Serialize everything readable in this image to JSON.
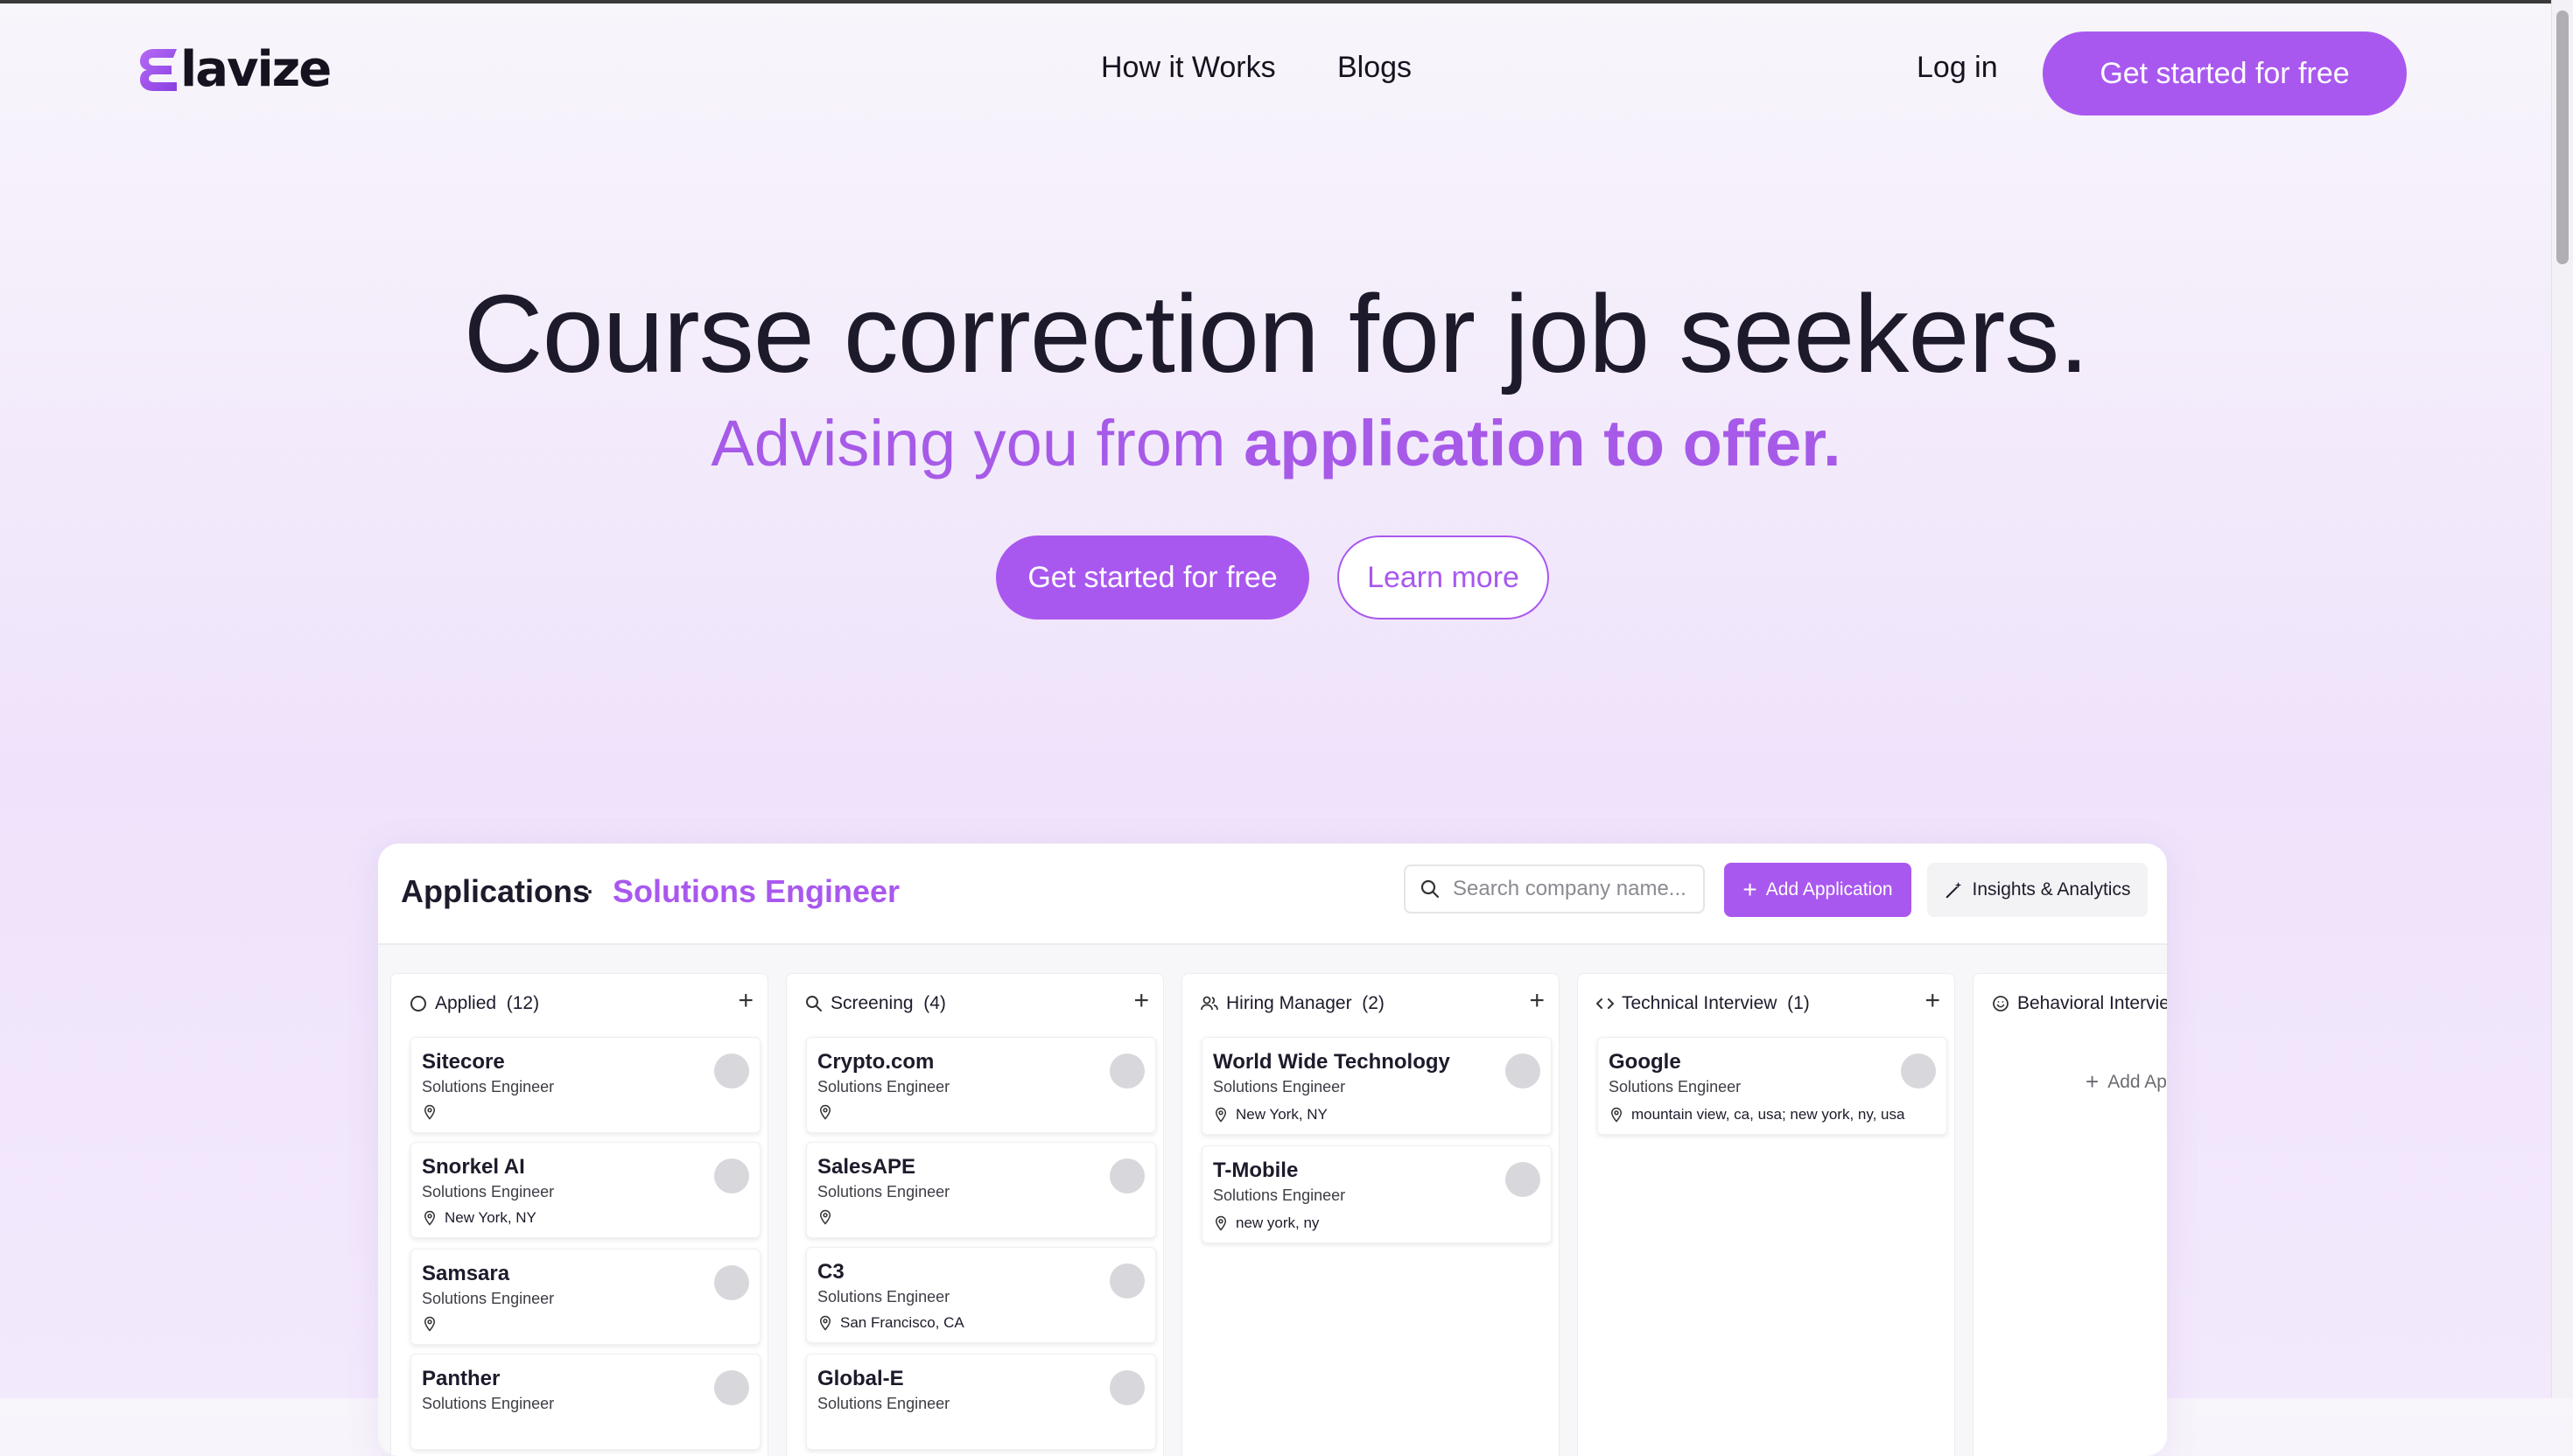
{
  "header": {
    "logo_text": "lavize",
    "nav": [
      "How it Works",
      "Blogs"
    ],
    "login": "Log in",
    "cta": "Get started for free"
  },
  "hero": {
    "title": "Course correction for job seekers.",
    "subtitle_plain": "Advising you from ",
    "subtitle_bold": "application to offer.",
    "cta_primary": "Get started for free",
    "cta_secondary": "Learn more"
  },
  "app": {
    "title": "Applications",
    "separator": "·",
    "role": "Solutions Engineer",
    "search_placeholder": "Search company name...",
    "add_button": "Add Application",
    "insights_button": "Insights & Analytics",
    "columns": [
      {
        "icon": "circle-icon",
        "label": "Applied",
        "count": "(12)",
        "cards": [
          {
            "name": "Sitecore",
            "role": "Solutions Engineer",
            "location": ""
          },
          {
            "name": "Snorkel AI",
            "role": "Solutions Engineer",
            "location": "New York, NY"
          },
          {
            "name": "Samsara",
            "role": "Solutions Engineer",
            "location": ""
          },
          {
            "name": "Panther",
            "role": "Solutions Engineer",
            "location": ""
          }
        ]
      },
      {
        "icon": "search-icon",
        "label": "Screening",
        "count": "(4)",
        "cards": [
          {
            "name": "Crypto.com",
            "role": "Solutions Engineer",
            "location": ""
          },
          {
            "name": "SalesAPE",
            "role": "Solutions Engineer",
            "location": ""
          },
          {
            "name": "C3",
            "role": "Solutions Engineer",
            "location": "San Francisco, CA"
          },
          {
            "name": "Global-E",
            "role": "Solutions Engineer",
            "location": ""
          }
        ]
      },
      {
        "icon": "users-icon",
        "label": "Hiring Manager",
        "count": "(2)",
        "cards": [
          {
            "name": "World Wide Technology",
            "role": "Solutions Engineer",
            "location": "New York, NY"
          },
          {
            "name": "T-Mobile",
            "role": "Solutions Engineer",
            "location": "new york, ny"
          }
        ]
      },
      {
        "icon": "code-icon",
        "label": "Technical Interview",
        "count": "(1)",
        "cards": [
          {
            "name": "Google",
            "role": "Solutions Engineer",
            "location": "mountain view, ca, usa; new york, ny, usa"
          }
        ]
      },
      {
        "icon": "smile-icon",
        "label": "Behavioral Interview",
        "count": "",
        "cards": []
      }
    ],
    "add_app_in_column": "Add App"
  },
  "colors": {
    "accent": "#a958ef",
    "text": "#1d1b2b"
  }
}
